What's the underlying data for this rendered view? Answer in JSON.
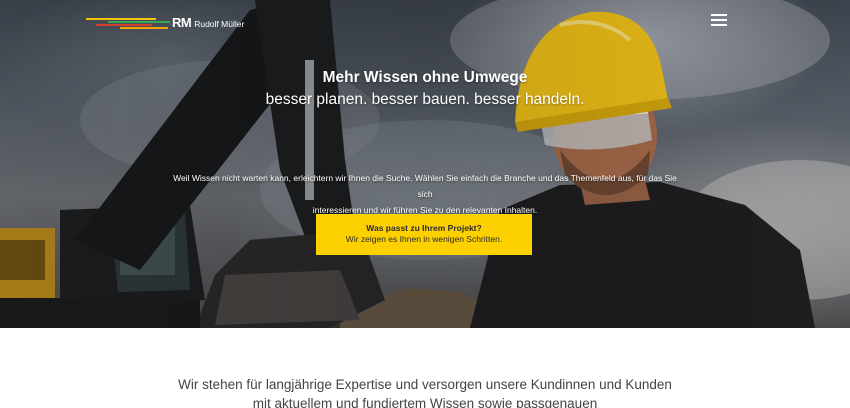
{
  "header": {
    "logo_mark": "RM",
    "logo_name": "Rudolf Müller",
    "logo_colors": [
      "#f2c500",
      "#3aa857",
      "#d6402b",
      "#f6a400",
      "#2a8fd1"
    ],
    "menu_icon": "hamburger-menu-icon"
  },
  "hero": {
    "headline": "Mehr Wissen ohne Umwege",
    "subheadline": "besser planen. besser bauen. besser handeln.",
    "intro_line1": "Weil Wissen nicht warten kann, erleichtern wir Ihnen die Suche. Wählen Sie einfach die Branche und das Themenfeld aus, für das Sie sich",
    "intro_line2": "interessieren und wir führen Sie zu den relevanten Inhalten.",
    "cta_title": "Was passt zu Ihrem Projekt?",
    "cta_subtitle": "Wir zeigen es Ihnen in wenigen Schritten.",
    "cta_color": "#fdd000"
  },
  "content": {
    "lead_line1": "Wir stehen für langjährige Expertise und versorgen unsere Kundinnen und Kunden",
    "lead_line2": "mit aktuellem und fundiertem Wissen sowie passgenauen"
  }
}
